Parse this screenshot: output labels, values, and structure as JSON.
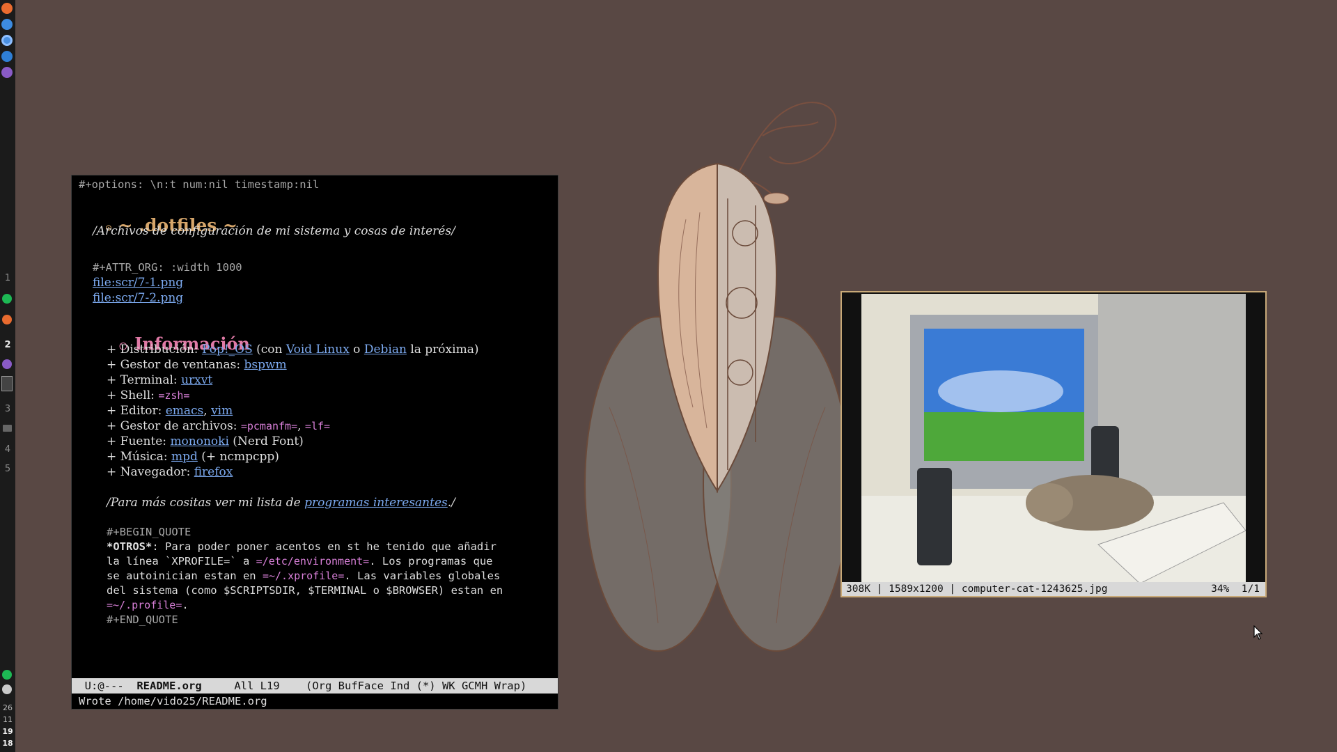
{
  "bar": {
    "apps_top": [
      {
        "icon": "firefox-icon",
        "color": "#e96b2f"
      },
      {
        "icon": "network-icon",
        "color": "#3d8be0"
      },
      {
        "icon": "chromium-icon",
        "color": "#4a90e2"
      },
      {
        "icon": "thunderbird-icon",
        "color": "#2f7fd6"
      },
      {
        "icon": "emacs-icon",
        "color": "#8a5bc7"
      }
    ],
    "workspaces": [
      {
        "label": "1",
        "active": false
      },
      {
        "label": "2",
        "active": true
      },
      {
        "label": "3",
        "active": false
      },
      {
        "label": "4",
        "active": false
      },
      {
        "label": "5",
        "active": false
      }
    ],
    "clock": [
      "26",
      "11",
      "19",
      "18"
    ]
  },
  "emacs": {
    "options_line": "#+options: \\n:t num:nil timestamp:nil",
    "title_prefix": "~ ",
    "title": ".dotfiles",
    "title_suffix": " ~",
    "subtitle": "/Archivos de configuración de mi sistema y cosas de interés/",
    "attr_line": "#+ATTR_ORG: :width 1000",
    "file_links": [
      "file:scr/7-1.png",
      "file:scr/7-2.png"
    ],
    "section_title": "Información",
    "items": {
      "distro_label": "+ Distribución: ",
      "distro_link": "Pop!_OS",
      "distro_mid": " (con ",
      "distro_link2": "Void Linux",
      "distro_or": " o ",
      "distro_link3": "Debian",
      "distro_end": " la próxima)",
      "wm_label": "+ Gestor de ventanas: ",
      "wm_link": "bspwm",
      "term_label": "+ Terminal: ",
      "term_link": "urxvt",
      "shell_label": "+ Shell: ",
      "shell_value": "=zsh=",
      "editor_label": "+ Editor: ",
      "editor_link1": "emacs",
      "editor_sep": ", ",
      "editor_link2": "vim",
      "fm_label": "+ Gestor de archivos: ",
      "fm_value1": "=pcmanfm=",
      "fm_sep": ", ",
      "fm_value2": "=lf=",
      "font_label": "+ Fuente: ",
      "font_link": "mononoki",
      "font_end": " (Nerd Font)",
      "music_label": "+ Música: ",
      "music_link": "mpd",
      "music_end": " (+ ncmpcpp)",
      "browser_label": "+ Navegador: ",
      "browser_link": "firefox"
    },
    "more_pre": "/Para más cositas ver mi lista de ",
    "more_link": "programas interesantes",
    "more_post": "./",
    "quote_begin": "#+BEGIN_QUOTE",
    "quote_l1_bold": "*OTROS*",
    "quote_l1": ": Para poder poner acentos en st he tenido que añadir",
    "quote_l2_a": "la línea `XPROFILE=` a ",
    "quote_l2_v": "=/etc/environment=",
    "quote_l2_b": ". Los programas que",
    "quote_l3_a": "se autoinician estan en ",
    "quote_l3_v": "=~/.xprofile=",
    "quote_l3_b": ". Las variables globales",
    "quote_l4": "del sistema (como $SCRIPTSDIR, $TERMINAL o $BROWSER) estan en",
    "quote_l5_v": "=~/.profile=",
    "quote_l5_b": ".",
    "quote_end": "#+END_QUOTE",
    "modeline": {
      "state": "U:@---",
      "buffer": "README.org",
      "position": "All L19",
      "modes": "(Org BufFace Ind (*) WK GCMH Wrap)"
    },
    "echo": "Wrote /home/vido25/README.org"
  },
  "viewer": {
    "size": "308K",
    "dimensions": "1589x1200",
    "filename": "computer-cat-1243625.jpg",
    "zoom": "34%",
    "index": "1/1"
  }
}
